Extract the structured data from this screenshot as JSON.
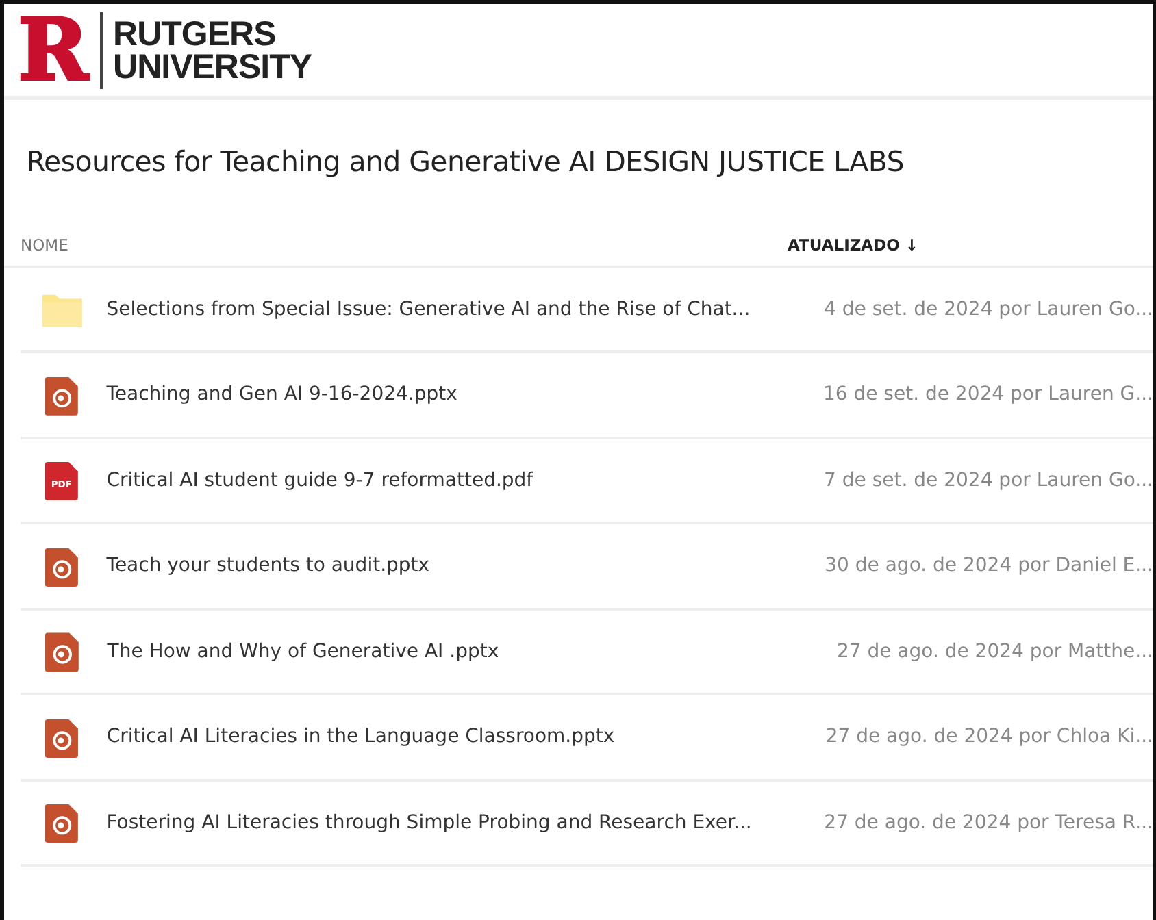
{
  "header": {
    "logo_letter": "R",
    "logo_lines": [
      "RUTGERS",
      "UNIVERSITY"
    ]
  },
  "title": "Resources for Teaching and Generative AI DESIGN JUSTICE LABS",
  "columns": [
    {
      "label": "NOME",
      "sorted": false
    },
    {
      "label": "ATUALIZADO",
      "sorted": true,
      "sort_indicator": "↓"
    }
  ],
  "rows": [
    {
      "kind": "folder",
      "name": "Selections from Special Issue: Generative AI and the Rise of Chat...",
      "updated": "4 de set. de 2024 por Lauren Go..."
    },
    {
      "kind": "pptx",
      "name": "Teaching and Gen AI 9-16-2024.pptx",
      "updated": "16 de set. de 2024 por Lauren G..."
    },
    {
      "kind": "pdf",
      "icon_text": "PDF",
      "name": "Critical AI student guide 9-7 reformatted.pdf",
      "updated": "7 de set. de 2024 por Lauren Go..."
    },
    {
      "kind": "pptx",
      "name": "Teach your students to audit.pptx",
      "updated": "30 de ago. de 2024 por Daniel E..."
    },
    {
      "kind": "pptx",
      "name": "The How and Why of Generative AI .pptx",
      "updated": "27 de ago. de 2024 por Matthe..."
    },
    {
      "kind": "pptx",
      "name": "Critical AI Literacies in the Language Classroom.pptx",
      "updated": "27 de ago. de 2024 por Chloa Ki..."
    },
    {
      "kind": "pptx",
      "name": "Fostering AI Literacies through Simple Probing and Research Exer...",
      "updated": "27 de ago. de 2024 por Teresa R..."
    }
  ]
}
